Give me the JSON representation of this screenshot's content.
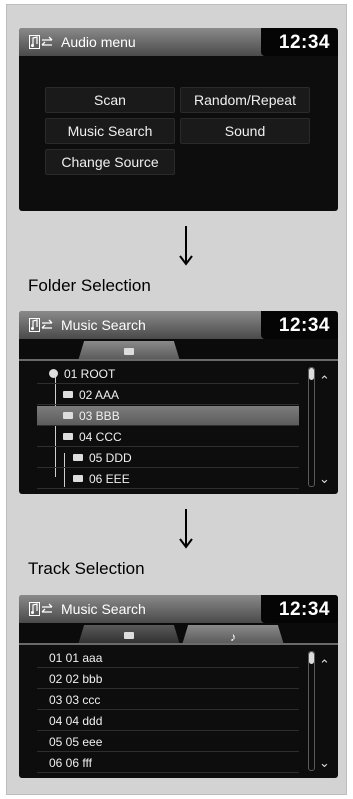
{
  "screen1": {
    "title": "Audio menu",
    "clock": "12:34",
    "header_icon": "music-source-icon",
    "menu_items": [
      "Scan",
      "Random/Repeat",
      "Music Search",
      "Sound",
      "Change Source"
    ]
  },
  "caption_folder": "Folder Selection",
  "screen2": {
    "title": "Music Search",
    "clock": "12:34",
    "tabs": [
      {
        "icon": "folder-icon",
        "active": true
      }
    ],
    "items": [
      {
        "label": "01 ROOT",
        "icon": "root-dot-icon"
      },
      {
        "label": "02 AAA",
        "icon": "folder-icon"
      },
      {
        "label": "03 BBB",
        "icon": "folder-icon",
        "selected": true
      },
      {
        "label": "04 CCC",
        "icon": "folder-icon"
      },
      {
        "label": "05 DDD",
        "icon": "folder-icon"
      },
      {
        "label": "06 EEE",
        "icon": "folder-icon"
      }
    ]
  },
  "caption_track": "Track Selection",
  "screen3": {
    "title": "Music Search",
    "clock": "12:34",
    "tabs": [
      {
        "icon": "folder-icon",
        "active": false
      },
      {
        "icon": "music-note-icon",
        "active": true
      }
    ],
    "tab_glyph_note": "♪",
    "items": [
      "01 01 aaa",
      "02 02 bbb",
      "03 03 ccc",
      "04 04 ddd",
      "05 05 eee",
      "06 06 fff"
    ]
  }
}
